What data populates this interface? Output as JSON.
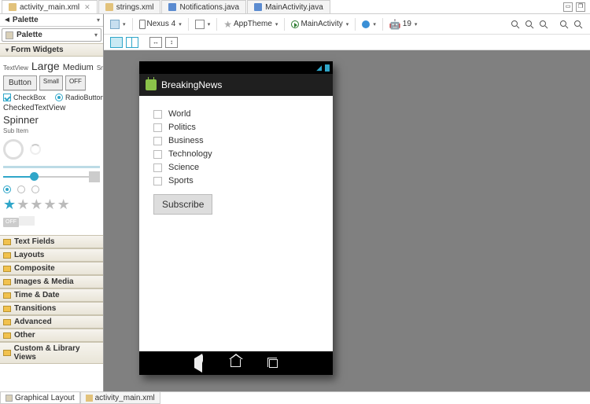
{
  "tabs": {
    "items": [
      {
        "label": "activity_main.xml",
        "type": "xml",
        "active": true,
        "closeable": true
      },
      {
        "label": "strings.xml",
        "type": "xml",
        "active": false
      },
      {
        "label": "Notifications.java",
        "type": "java",
        "active": false
      },
      {
        "label": "MainActivity.java",
        "type": "java",
        "active": false
      }
    ]
  },
  "palette": {
    "header_back": "◄",
    "title": "Palette",
    "sections": {
      "form_widgets": "Form Widgets",
      "text_fields": "Text Fields",
      "layouts": "Layouts",
      "composite": "Composite",
      "images_media": "Images & Media",
      "time_date": "Time & Date",
      "transitions": "Transitions",
      "advanced": "Advanced",
      "other": "Other",
      "custom": "Custom & Library Views"
    },
    "widgets": {
      "textview": "TextView",
      "large": "Large",
      "medium": "Medium",
      "small": "Small",
      "button": "Button",
      "btn_small": "Small",
      "btn_off": "OFF",
      "checkbox": "CheckBox",
      "radiobutton": "RadioButton",
      "checkedtextview": "CheckedTextView",
      "spinner": "Spinner",
      "subitem": "Sub Item",
      "toggle_off": "OFF"
    }
  },
  "toolbar": {
    "device": "Nexus 4",
    "theme": "AppTheme",
    "activity": "MainActivity",
    "api": "19"
  },
  "preview": {
    "app_title": "BreakingNews",
    "topics": [
      "World",
      "Politics",
      "Business",
      "Technology",
      "Science",
      "Sports"
    ],
    "subscribe": "Subscribe"
  },
  "bottom_tabs": {
    "graphical": "Graphical Layout",
    "source": "activity_main.xml"
  }
}
